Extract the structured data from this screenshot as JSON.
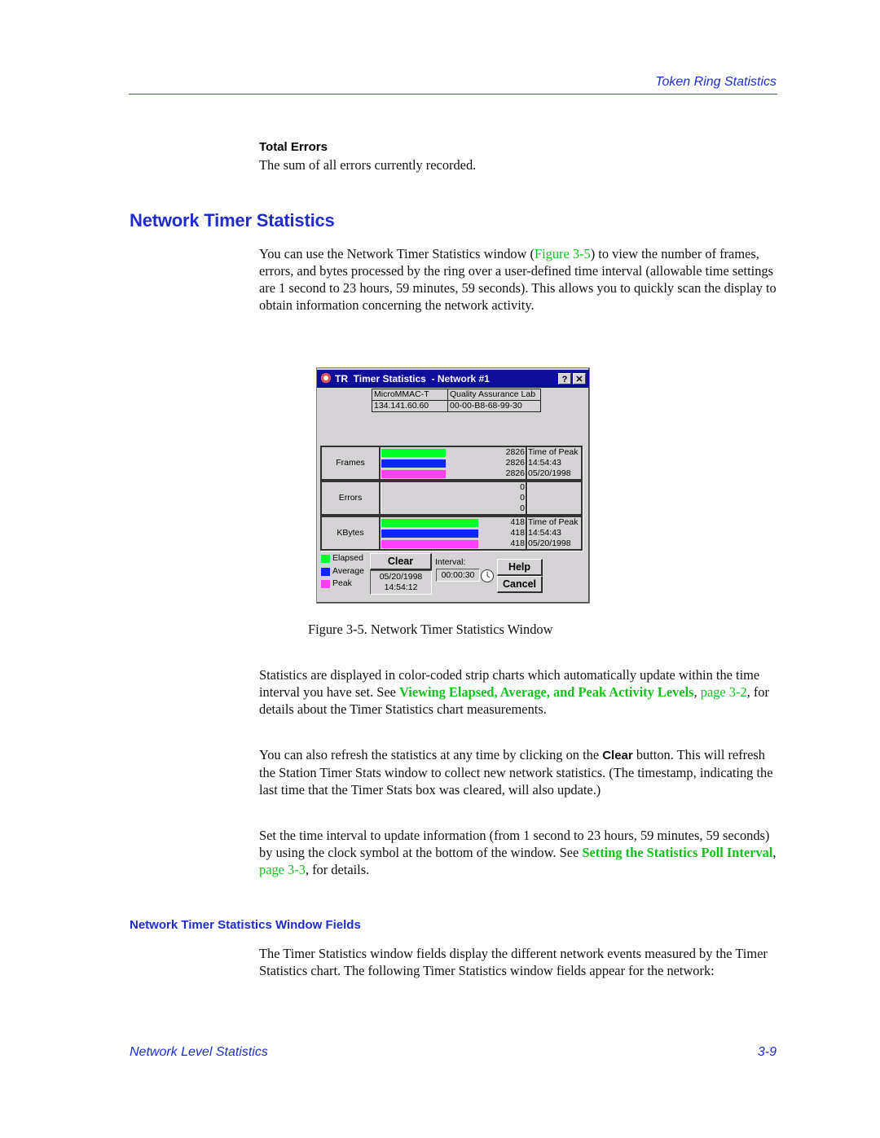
{
  "header": {
    "section_title": "Token Ring Statistics"
  },
  "total_errors": {
    "heading": "Total Errors",
    "body": "The sum of all errors currently recorded."
  },
  "network_timer": {
    "heading": "Network Timer Statistics",
    "intro": {
      "before_link": "You can use the Network Timer Statistics window (",
      "link": "Figure 3-5",
      "after_link": ") to view the number of frames, errors, and bytes processed by the ring over a user-defined time interval (allowable time settings are 1 second to 23 hours, 59 minutes, 59 seconds). This allows you to quickly scan the display to obtain information concerning the network activity."
    }
  },
  "dialog": {
    "title": "TR  Timer Statistics  - Network #1",
    "help_glyph": "?",
    "close_glyph": "✕",
    "device_name": "MicroMMAC-T",
    "location": "Quality Assurance Lab",
    "ip_address": "134.141.60.60",
    "mac_address": "00-00-B8-68-99-30",
    "colors": {
      "elapsed": "#00ff2a",
      "average": "#0f25ff",
      "peak": "#ff40ff"
    },
    "groups": [
      {
        "label": "Frames",
        "elapsed": 2826,
        "average": 2826,
        "peak": 2826,
        "bar_fraction": 0.44,
        "peak_label": "Time of Peak",
        "peak_time": "14:54:43",
        "peak_date": "05/20/1998"
      },
      {
        "label": "Errors",
        "elapsed": 0,
        "average": 0,
        "peak": 0,
        "bar_fraction": 0,
        "peak_label": "",
        "peak_time": "",
        "peak_date": ""
      },
      {
        "label": "KBytes",
        "elapsed": 418,
        "average": 418,
        "peak": 418,
        "bar_fraction": 0.66,
        "peak_label": "Time of Peak",
        "peak_time": "14:54:43",
        "peak_date": "05/20/1998"
      }
    ],
    "legend": {
      "elapsed": "Elapsed",
      "average": "Average",
      "peak": "Peak"
    },
    "clear_label": "Clear",
    "cleared_date": "05/20/1998",
    "cleared_time": "14:54:12",
    "interval_label": "Interval:",
    "interval_value": "00:00:30",
    "help_label": "Help",
    "cancel_label": "Cancel"
  },
  "figure_caption": "Figure 3-5.  Network Timer Statistics Window",
  "stats_para": {
    "before": "Statistics are displayed in color-coded strip charts which automatically update within the time interval you have set. See ",
    "link_bold": "Viewing Elapsed, Average, and Peak Activity Levels",
    "sep": ", ",
    "link_page": "page 3-2",
    "after": ", for details about the Timer Statistics chart measurements."
  },
  "refresh_para": {
    "before": "You can also refresh the statistics at any time by clicking on the ",
    "bold": "Clear",
    "after": " button. This will refresh the Station Timer Stats window to collect new network statistics. (The timestamp, indicating the last time that the Timer Stats box was cleared, will also update.)"
  },
  "interval_para": {
    "before": "Set the time interval to update information (from 1 second to 23 hours, 59 minutes, 59 seconds) by using the clock symbol at the bottom of the window. See ",
    "link_bold": "Setting the Statistics Poll Interval",
    "sep": ", ",
    "link_page": "page 3-3",
    "after": ", for details."
  },
  "fields_section": {
    "heading": "Network Timer Statistics Window Fields",
    "body": "The Timer Statistics window fields display the different network events measured by the Timer Statistics chart. The following Timer Statistics window fields appear for the network:"
  },
  "footer": {
    "left": "Network Level Statistics",
    "page_number": "3-9"
  }
}
